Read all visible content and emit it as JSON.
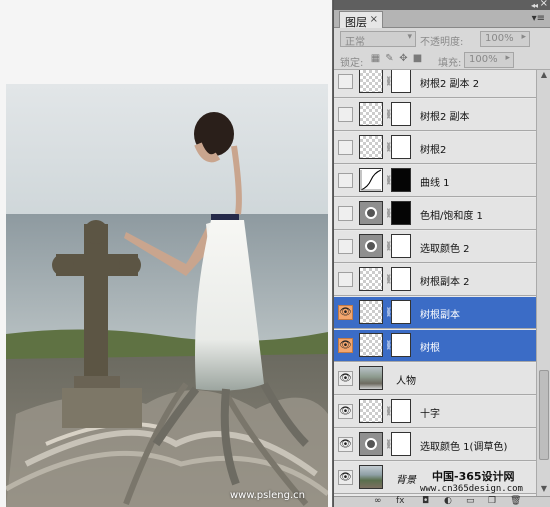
{
  "canvas": {
    "watermark": "www.psleng.cn"
  },
  "panel": {
    "tab_label": "图层",
    "tab_close": "×",
    "blend_mode": "正常",
    "opacity_label": "不透明度:",
    "opacity_value": "100%",
    "lock_label": "锁定:",
    "fill_label": "填充:",
    "fill_value": "100%"
  },
  "layers": [
    {
      "name": "树根2 副本 2",
      "thumb": "checker",
      "mask": "white",
      "selected": false,
      "visible": false
    },
    {
      "name": "树根2 副本",
      "thumb": "checker",
      "mask": "white",
      "selected": false,
      "visible": false
    },
    {
      "name": "树根2",
      "thumb": "checker",
      "mask": "white",
      "selected": false,
      "visible": false
    },
    {
      "name": "曲线 1",
      "thumb": "curve",
      "mask": "black",
      "selected": false,
      "visible": false
    },
    {
      "name": "色相/饱和度 1",
      "thumb": "adj",
      "mask": "black",
      "selected": false,
      "visible": false
    },
    {
      "name": "选取颜色 2",
      "thumb": "adj",
      "mask": "white",
      "selected": false,
      "visible": false
    },
    {
      "name": "树根副本 2",
      "thumb": "checker",
      "mask": "white",
      "selected": false,
      "visible": false
    },
    {
      "name": "树根副本",
      "thumb": "checker",
      "mask": "white",
      "selected": true,
      "visible": true
    },
    {
      "name": "树根",
      "thumb": "checker",
      "mask": "white",
      "selected": true,
      "visible": true
    },
    {
      "name": "人物",
      "thumb": "photo",
      "mask": "",
      "selected": false,
      "visible": true
    },
    {
      "name": "十字",
      "thumb": "checker",
      "mask": "white",
      "selected": false,
      "visible": true
    },
    {
      "name": "选取颜色 1(调草色)",
      "thumb": "adj",
      "mask": "white",
      "selected": false,
      "visible": true
    },
    {
      "name": "背景",
      "thumb": "bg",
      "mask": "",
      "selected": false,
      "visible": true,
      "italic": true
    }
  ],
  "site_watermark": {
    "line1": "中国-365设计网",
    "line2": "www.cn365design.com"
  },
  "colors": {
    "selected_row": "#3b6cc6",
    "eye_highlight": "#f3a66e",
    "panel_bg": "#d8d8d8"
  }
}
